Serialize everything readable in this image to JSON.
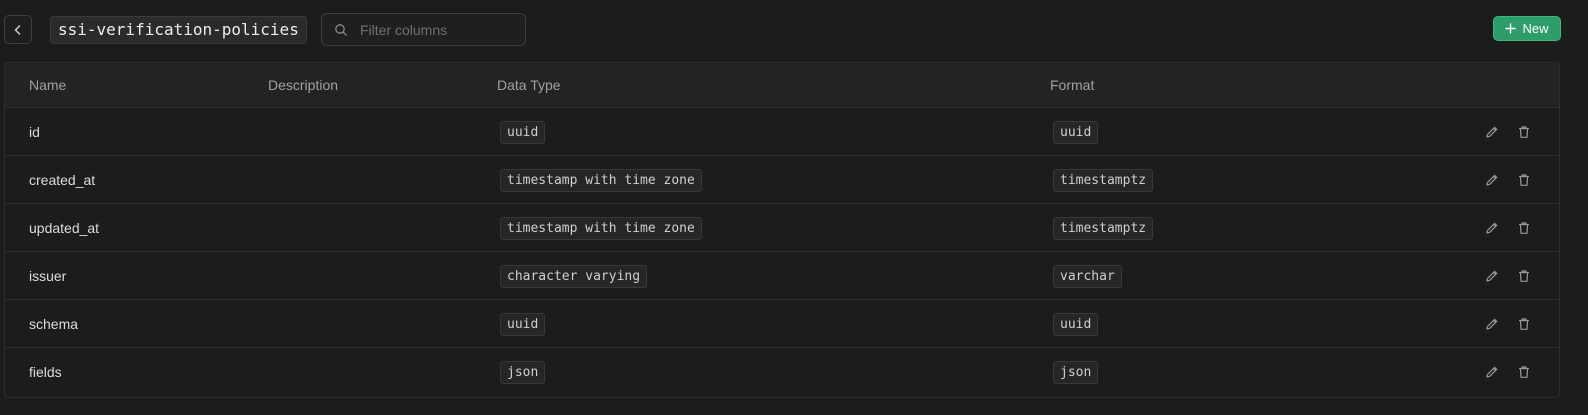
{
  "header": {
    "back_icon": "chevron-left-icon",
    "table_name": "ssi-verification-policies",
    "filter": {
      "placeholder": "Filter columns",
      "value": "",
      "icon": "search-icon"
    },
    "new_button": {
      "label": "New",
      "icon": "plus-icon"
    }
  },
  "columns": {
    "name": "Name",
    "description": "Description",
    "data_type": "Data Type",
    "format": "Format"
  },
  "rows": [
    {
      "name": "id",
      "description": "",
      "data_type": "uuid",
      "format": "uuid"
    },
    {
      "name": "created_at",
      "description": "",
      "data_type": "timestamp with time zone",
      "format": "timestamptz"
    },
    {
      "name": "updated_at",
      "description": "",
      "data_type": "timestamp with time zone",
      "format": "timestamptz"
    },
    {
      "name": "issuer",
      "description": "",
      "data_type": "character varying",
      "format": "varchar"
    },
    {
      "name": "schema",
      "description": "",
      "data_type": "uuid",
      "format": "uuid"
    },
    {
      "name": "fields",
      "description": "",
      "data_type": "json",
      "format": "json"
    }
  ],
  "row_actions": {
    "edit_icon": "pencil-icon",
    "delete_icon": "trash-icon"
  },
  "colors": {
    "accent": "#2f9d6a",
    "background": "#1c1c1c",
    "header_bg": "#232323",
    "border": "#2e2e2e"
  }
}
